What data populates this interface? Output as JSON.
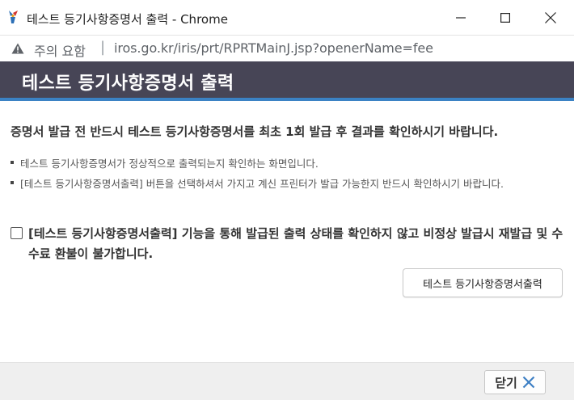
{
  "window": {
    "title": "테스트 등기사항증명서 출력 - Chrome"
  },
  "addressbar": {
    "warning": "주의 요함",
    "separator": "|",
    "url": "iros.go.kr/iris/prt/RPRTMainJ.jsp?openerName=fee"
  },
  "header": {
    "title": "테스트 등기사항증명서 출력"
  },
  "content": {
    "main_notice": "증명서 발급 전 반드시 테스트 등기사항증명서를 최초 1회 발급 후 결과를 확인하시기 바랍니다.",
    "bullets": [
      "테스트 등기사항증명서가 정상적으로 출력되는지 확인하는 화면입니다.",
      "[테스트 등기사항증명서출력] 버튼을 선택하셔서 가지고 계신 프린터가 발급 가능한지 반드시 확인하시기 바랍니다."
    ],
    "agree_text": "[테스트 등기사항증명서출력] 기능을 통해 발급된 출력 상태를 확인하지 않고 비정상 발급시 재발급 및 수수료 환불이 불가합니다.",
    "print_button": "테스트 등기사항증명서출력"
  },
  "footer": {
    "close_button": "닫기"
  },
  "colors": {
    "header_bg": "#474556",
    "header_accent": "#3b82c4",
    "close_x": "#3d7fc4"
  }
}
